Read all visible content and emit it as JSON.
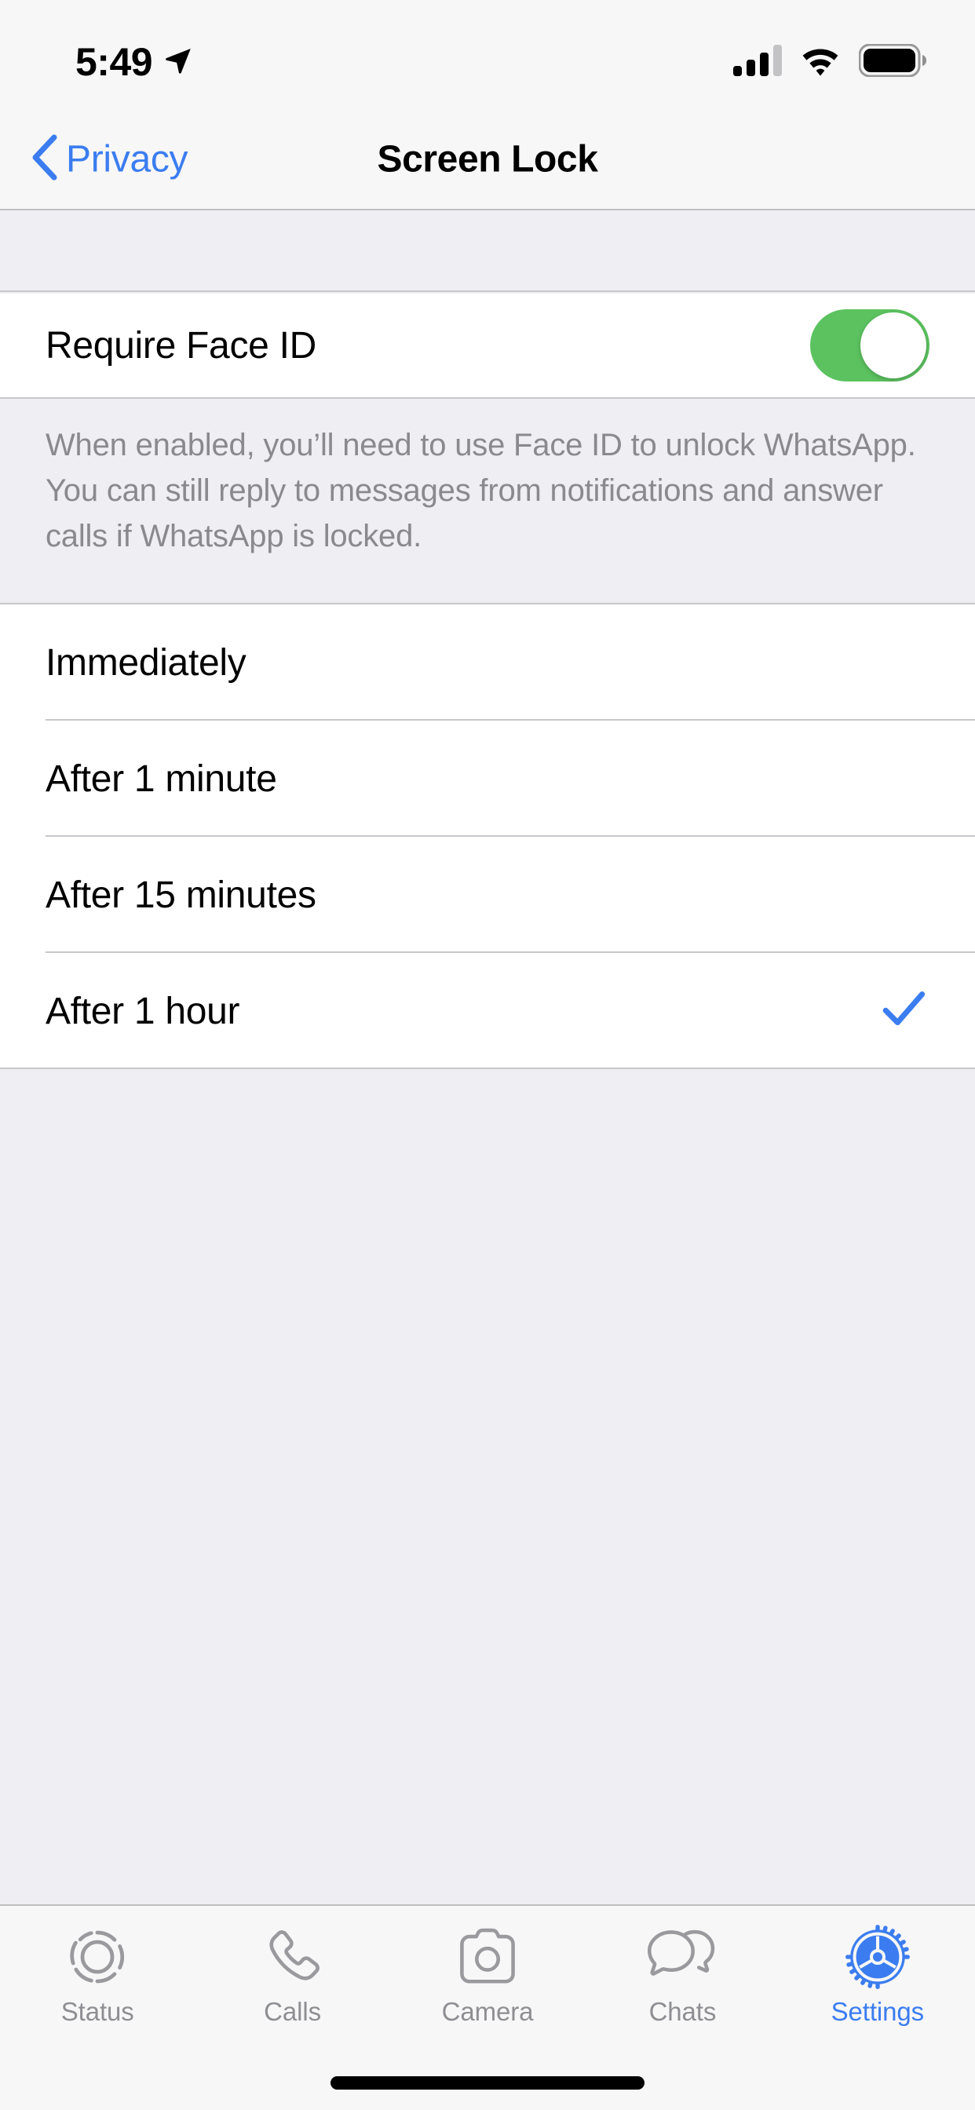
{
  "status_bar": {
    "time": "5:49",
    "location_icon": "location-arrow-icon",
    "cellular_icon": "cellular-signal-icon",
    "cellular_bars_filled": 3,
    "cellular_bars_total": 4,
    "wifi_icon": "wifi-icon",
    "battery_icon": "battery-full-icon"
  },
  "nav": {
    "back_icon": "chevron-left-icon",
    "back_label": "Privacy",
    "title": "Screen Lock",
    "tint": "#3B7DF0"
  },
  "toggle_section": {
    "label": "Require Face ID",
    "switch_icon": "toggle-switch-on-icon",
    "switch_on": true,
    "switch_color": "#5BC25F"
  },
  "footer_note": {
    "text": "When enabled, you’ll need to use Face ID to unlock WhatsApp. You can still reply to messages from notifications and answer calls if WhatsApp is locked."
  },
  "options_section": {
    "selected_index": 3,
    "check_icon": "checkmark-icon",
    "check_color": "#3B7DF0",
    "items": [
      {
        "label": "Immediately",
        "selected": false
      },
      {
        "label": "After 1 minute",
        "selected": false
      },
      {
        "label": "After 15 minutes",
        "selected": false
      },
      {
        "label": "After 1 hour",
        "selected": true
      }
    ]
  },
  "tab_bar": {
    "active_index": 4,
    "active_color": "#3B7DF0",
    "inactive_color": "#8E8E93",
    "tabs": [
      {
        "label": "Status",
        "icon": "status-rings-icon"
      },
      {
        "label": "Calls",
        "icon": "phone-handset-icon"
      },
      {
        "label": "Camera",
        "icon": "camera-icon"
      },
      {
        "label": "Chats",
        "icon": "chat-bubbles-icon"
      },
      {
        "label": "Settings",
        "icon": "gear-icon"
      }
    ]
  },
  "home_indicator": "home-indicator"
}
